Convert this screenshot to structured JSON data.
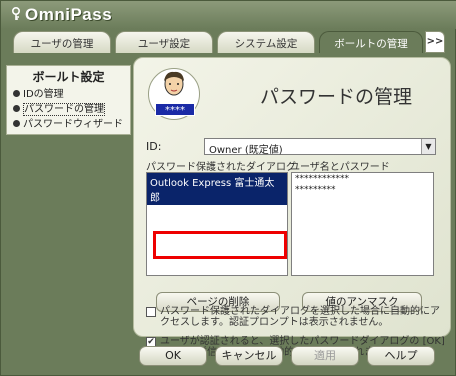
{
  "app": {
    "title": "OmniPass"
  },
  "tabs": [
    {
      "label": "ユーザの管理"
    },
    {
      "label": "ユーザ設定"
    },
    {
      "label": "システム設定"
    },
    {
      "label": "ボールトの管理"
    }
  ],
  "tab_more": ">>",
  "sidebar": {
    "title": "ボールト設定",
    "items": [
      {
        "label": "IDの管理"
      },
      {
        "label": "パスワードの管理"
      },
      {
        "label": "パスワードウィザード"
      }
    ]
  },
  "main": {
    "title": "パスワードの管理",
    "avatar_badge": "****",
    "id_label": "ID:",
    "id_value": "Owner (既定値)",
    "dialogs_label": "パスワード保護されたダイアログ",
    "credentials_label": "ユーザ名とパスワード",
    "dialogs": [
      {
        "label": "Outlook Express 富士通太郎"
      }
    ],
    "credentials": [
      {
        "value": "************"
      },
      {
        "value": "*********"
      }
    ],
    "delete_button": "ページの削除",
    "unmask_button": "値のアンマスク",
    "option1_text": "パスワード保護されたダイアログを選択した場合に自動的にアクセスします。認証プロンプトは表示されません。",
    "option2_text": "ユーザが認証されると、選択したパスワードダイアログの [OK] または [送信] ボタンが自動的にクリックされます。",
    "option2_checked": "✔"
  },
  "footer": {
    "ok": "OK",
    "cancel": "キャンセル",
    "apply": "適用",
    "help": "ヘルプ"
  },
  "colors": {
    "frame": "#6b7c5a",
    "highlight": "#e00000",
    "selection": "#0a246a"
  }
}
